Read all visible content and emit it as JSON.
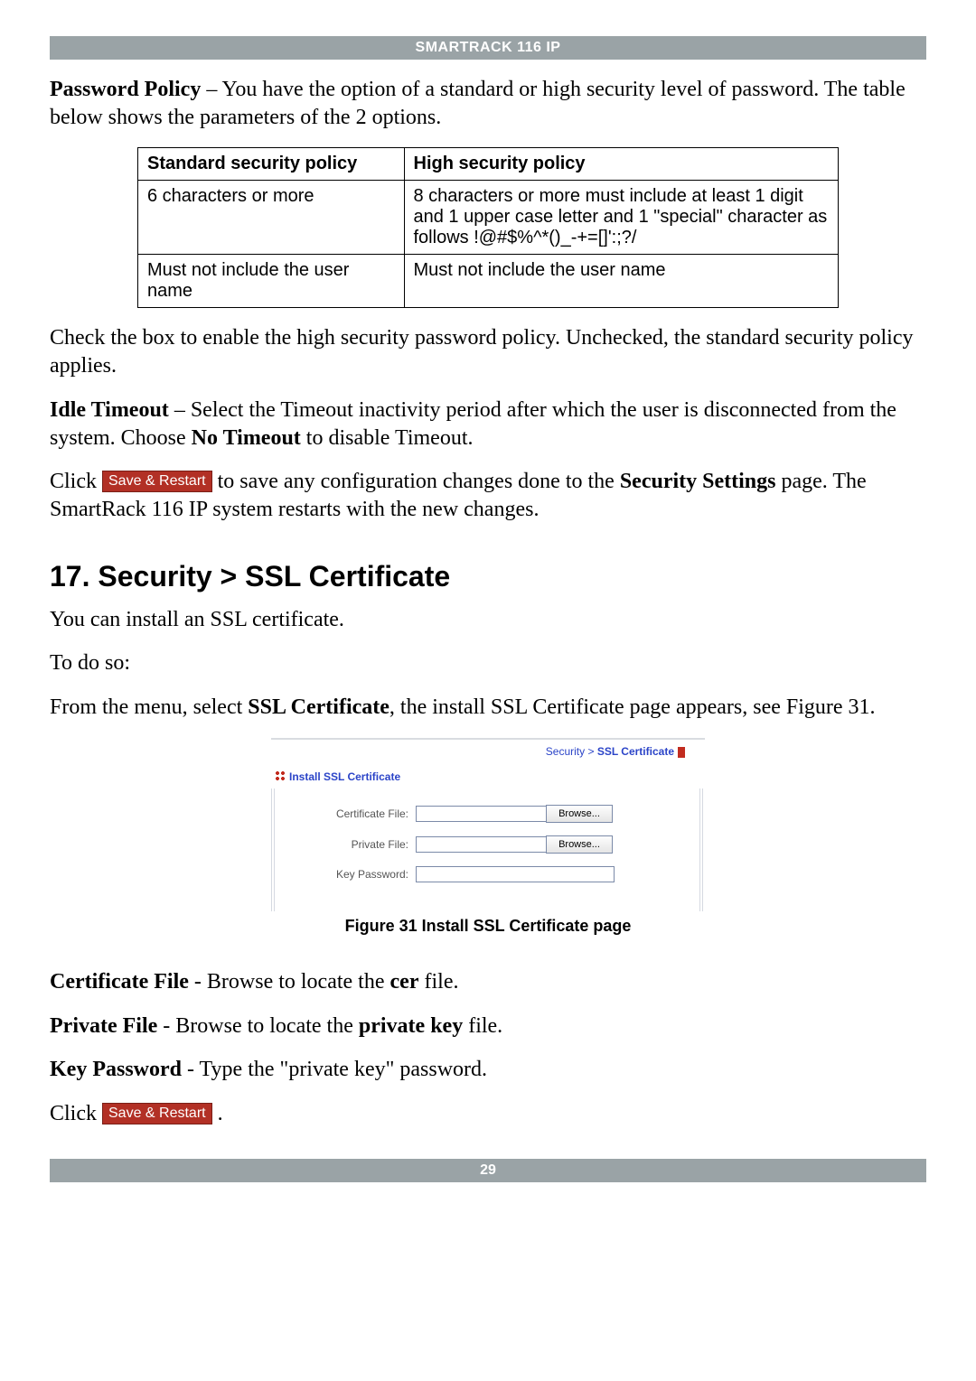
{
  "header": {
    "title": "SMARTRACK 116 IP"
  },
  "intro": {
    "password_policy_label": "Password Policy",
    "password_policy_rest": " – You have the option of a standard or high security level of password. The table below shows the parameters of the 2 options."
  },
  "policy_table": {
    "headers": {
      "std": "Standard security policy",
      "high": "High security policy"
    },
    "rows": [
      {
        "std": "6 characters or more",
        "high": "8 characters or more must include at least 1 digit and 1 upper case letter and 1 \"special\" character as follows !@#$%^*()_-+=[]':;?/"
      },
      {
        "std": "Must not include the user name",
        "high": "Must not include the user name"
      }
    ]
  },
  "checkbox_note": "Check the box to enable the high security password policy. Unchecked, the standard security policy applies.",
  "idle": {
    "label": "Idle Timeout",
    "rest_a": " – Select the Timeout inactivity period after which the user is disconnected from the system. Choose ",
    "no_timeout": "No Timeout",
    "rest_b": " to disable Timeout."
  },
  "save_restart_btn": "Save & Restart",
  "save_line": {
    "pre": "Click ",
    "mid": " to save any configuration changes done to the ",
    "sec_settings": "Security Settings",
    "post": " page. The SmartRack 116 IP system restarts with the new changes."
  },
  "section_heading": "17. Security > SSL Certificate",
  "ssl_intro": "You can install an SSL certificate.",
  "to_do_so": "To do so:",
  "from_menu": {
    "a": "From the menu, select ",
    "bold": "SSL Certificate",
    "b": ", the install SSL Certificate page appears, see Figure 31."
  },
  "screenshot": {
    "crumb1": "Security",
    "sep": " > ",
    "crumb2": "SSL Certificate",
    "section_label": "Install SSL Certificate",
    "fields": {
      "cert_label": "Certificate File:",
      "priv_label": "Private File:",
      "key_label": "Key Password:",
      "browse": "Browse..."
    }
  },
  "figure_caption": "Figure 31 Install SSL Certificate page",
  "cert_file": {
    "label": "Certificate File",
    "mid": " - Browse to locate the ",
    "bold": "cer",
    "end": " file."
  },
  "priv_file": {
    "label": "Private File",
    "mid": " - Browse to locate the ",
    "bold": "private key",
    "end": " file."
  },
  "key_pass": {
    "label": "Key Password",
    "rest": " - Type the \"private key\" password."
  },
  "final_click": {
    "pre": "Click ",
    "post": " ."
  },
  "footer": {
    "page_number": "29"
  }
}
